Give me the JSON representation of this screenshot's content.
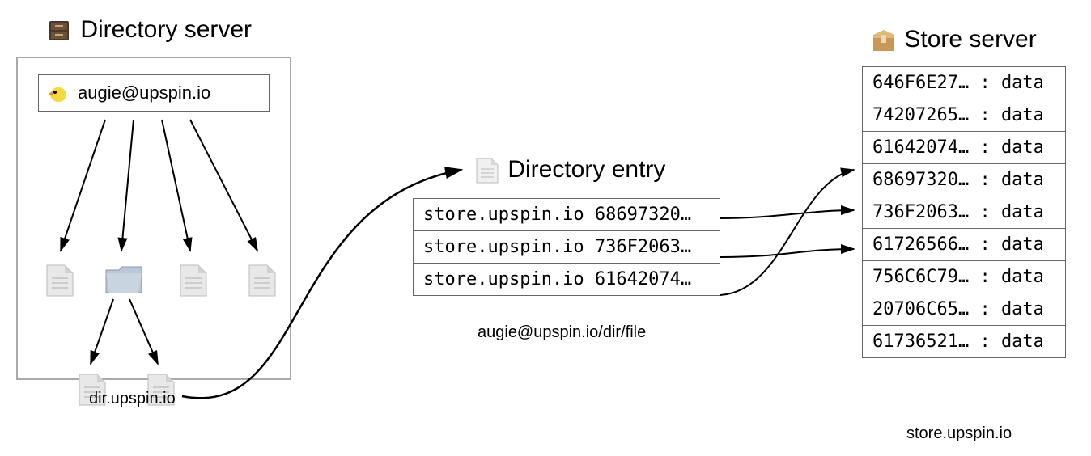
{
  "directory_server": {
    "title": "Directory server",
    "user": "augie@upspin.io",
    "caption": "dir.upspin.io"
  },
  "directory_entry": {
    "title": "Directory entry",
    "caption": "augie@upspin.io/dir/file",
    "rows": [
      "store.upspin.io 68697320…",
      "store.upspin.io 736F2063…",
      "store.upspin.io 61642074…"
    ]
  },
  "store_server": {
    "title": "Store server",
    "caption": "store.upspin.io",
    "rows": [
      "646F6E27… : data",
      "74207265… : data",
      "61642074… : data",
      "68697320… : data",
      "736F2063… : data",
      "61726566… : data",
      "756C6C79… : data",
      "20706C65… : data",
      "61736521… : data"
    ]
  }
}
